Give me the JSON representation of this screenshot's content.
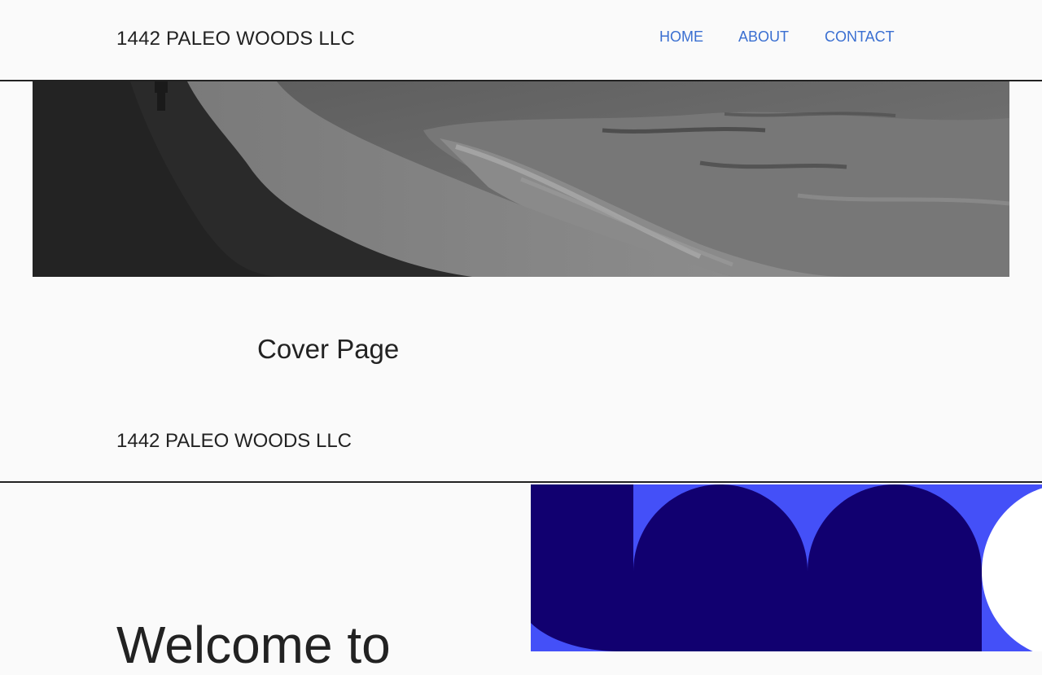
{
  "header": {
    "site_title": "1442 PALEO WOODS LLC",
    "nav": [
      {
        "label": "HOME"
      },
      {
        "label": "ABOUT"
      },
      {
        "label": "CONTACT"
      }
    ]
  },
  "main": {
    "cover_title": "Cover Page",
    "company_name": "1442 PALEO WOODS LLC",
    "welcome_heading": "Welcome to"
  },
  "colors": {
    "nav_link": "#3a6fd1",
    "graphic_blue": "#4450f8",
    "graphic_navy": "#110070"
  }
}
